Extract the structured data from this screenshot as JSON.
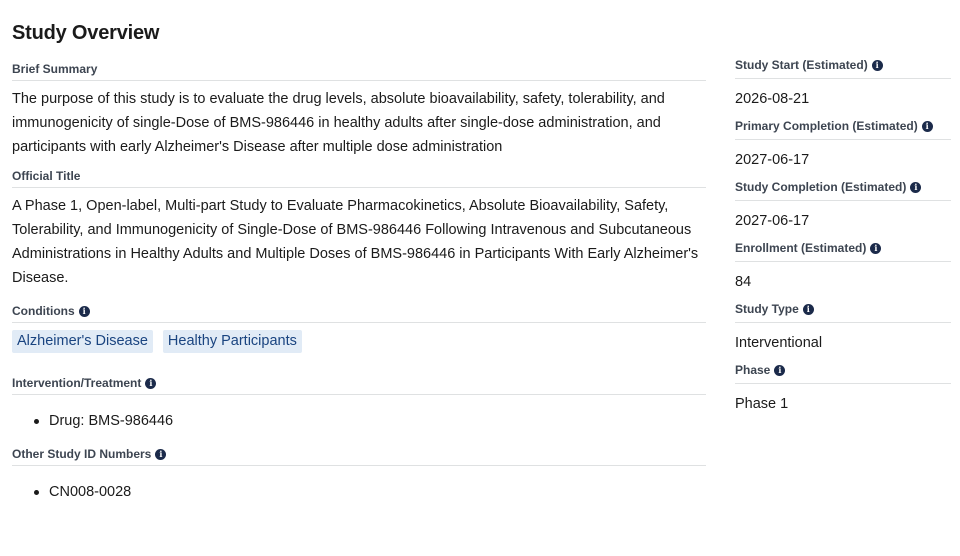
{
  "page_title": "Study Overview",
  "summary": {
    "label": "Brief Summary",
    "text": "The purpose of this study is to evaluate the drug levels, absolute bioavailability, safety, tolerability, and immunogenicity of single-Dose of BMS-986446 in healthy adults after single-dose administration, and participants with early Alzheimer's Disease after multiple dose administration"
  },
  "official_title": {
    "label": "Official Title",
    "text": "A Phase 1, Open-label, Multi-part Study to Evaluate Pharmacokinetics, Absolute Bioavailability, Safety, Tolerability, and Immunogenicity of Single-Dose of BMS-986446 Following Intravenous and Subcutaneous Administrations in Healthy Adults and Multiple Doses of BMS-986446 in Participants With Early Alzheimer's Disease."
  },
  "conditions": {
    "label": "Conditions",
    "tags": [
      "Alzheimer's Disease",
      "Healthy Participants"
    ]
  },
  "intervention": {
    "label": "Intervention/Treatment",
    "items": [
      "Drug: BMS-986446"
    ]
  },
  "other_ids": {
    "label": "Other Study ID Numbers",
    "items": [
      "CN008-0028"
    ]
  },
  "sidebar": {
    "study_start": {
      "label": "Study Start (Estimated)",
      "value": "2026-08-21"
    },
    "primary_completion": {
      "label": "Primary Completion (Estimated)",
      "value": "2027-06-17"
    },
    "study_completion": {
      "label": "Study Completion (Estimated)",
      "value": "2027-06-17"
    },
    "enrollment": {
      "label": "Enrollment (Estimated)",
      "value": "84"
    },
    "study_type": {
      "label": "Study Type",
      "value": "Interventional"
    },
    "phase": {
      "label": "Phase",
      "value": "Phase 1"
    }
  },
  "icons": {
    "info": "info-icon",
    "info_glyph": "i"
  },
  "colors": {
    "tag_bg": "#e1ebf6",
    "tag_text": "#1a4480",
    "divider": "#dfe1e2",
    "icon": "#1b2a4a"
  }
}
